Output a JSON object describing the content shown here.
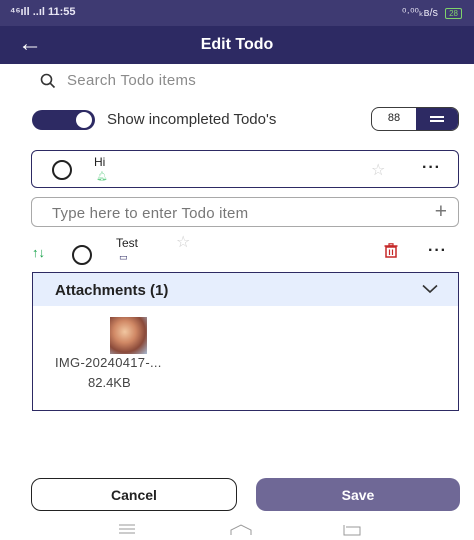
{
  "status_bar": {
    "left_text": "⁴⁶ıll ..ıl 11:55",
    "right_text": "⁰·⁰⁰ₖʙ/s",
    "battery": "28"
  },
  "header": {
    "title": "Edit Todo",
    "back_icon": "arrow-left-icon"
  },
  "search": {
    "placeholder": "Search Todo items"
  },
  "filter": {
    "toggle_on": true,
    "label": "Show incompleted Todo's",
    "grid_label": "88",
    "active_view": "list"
  },
  "todos": [
    {
      "title": "Hi",
      "has_reminder": true,
      "starred": false,
      "completed": false
    },
    {
      "title": "Test",
      "has_attachment": true,
      "starred": false,
      "completed": false
    }
  ],
  "new_item": {
    "placeholder": "Type here to enter Todo item"
  },
  "attachments": {
    "header": "Attachments (1)",
    "files": [
      {
        "name": "IMG-20240417-...",
        "size": "82.4KB"
      }
    ]
  },
  "actions": {
    "cancel_label": "Cancel",
    "save_label": "Save"
  },
  "colors": {
    "primary": "#2d2a63",
    "save_button": "#6f6896",
    "attachment_header_bg": "#e6eefd",
    "delete_red": "#c62828",
    "sort_green": "#17a34a"
  }
}
